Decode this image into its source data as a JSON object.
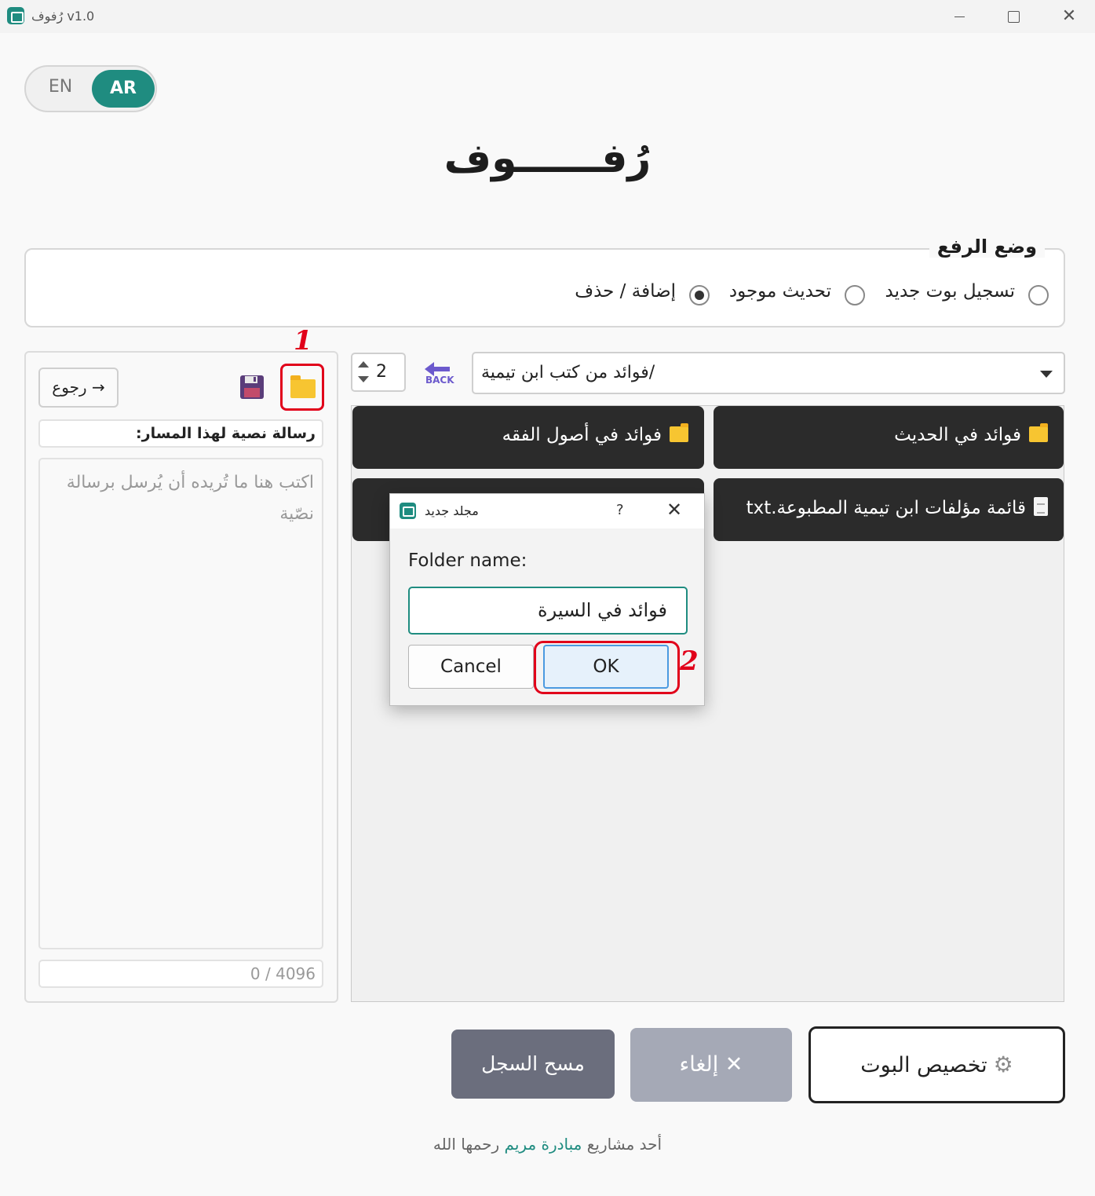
{
  "window": {
    "title": "رُفوف v1.0",
    "controls": [
      "minimize-icon",
      "maximize-icon",
      "close-icon"
    ]
  },
  "lang_toggle": {
    "en": "EN",
    "ar": "AR",
    "active": "AR"
  },
  "app_heading": "رُفــــــوف",
  "upload_mode": {
    "legend": "وضع الرفع",
    "options": [
      {
        "label": "تسجيل بوت جديد",
        "selected": false
      },
      {
        "label": "تحديث موجود",
        "selected": false
      },
      {
        "label": "إضافة / حذف",
        "selected": true
      }
    ]
  },
  "left_panel": {
    "back_label": "→ رجوع",
    "save_icon": "save-icon",
    "new_folder_icon": "folder-icon",
    "message_label": "رسالة نصية لهذا المسار:",
    "message_placeholder": "اكتب هنا ما تُريده أن يُرسل برسالة نصّية",
    "char_count": "0 / 4096"
  },
  "browser": {
    "columns_value": "2",
    "back_icon_text": "BACK",
    "path": "/فوائد من كتب ابن تيمية",
    "items": [
      {
        "label": "فوائد في الحديث",
        "type": "folder"
      },
      {
        "label": "فوائد في أصول الفقه",
        "type": "folder"
      },
      {
        "label": "قائمة مؤلفات ابن تيمية المطبوعة.txt",
        "type": "file"
      }
    ]
  },
  "dialog": {
    "title": "مجلد جديد",
    "help": "?",
    "close": "✕",
    "label": "Folder name:",
    "value": "فوائد في السيرة",
    "cancel": "Cancel",
    "ok": "OK"
  },
  "annotations": {
    "step1": "1",
    "step2": "2",
    "color": "#e1001a"
  },
  "actions": {
    "clear_log": "مسح السجل",
    "cancel": "✕ إلغاء",
    "customize": "تخصيص البوت"
  },
  "footer": {
    "prefix": "أحد مشاريع",
    "link": "مبادرة مريم",
    "suffix": "رحمها الله"
  },
  "colors": {
    "accent": "#1f8c80",
    "tile": "#2b2b2b",
    "annotation": "#e1001a"
  }
}
